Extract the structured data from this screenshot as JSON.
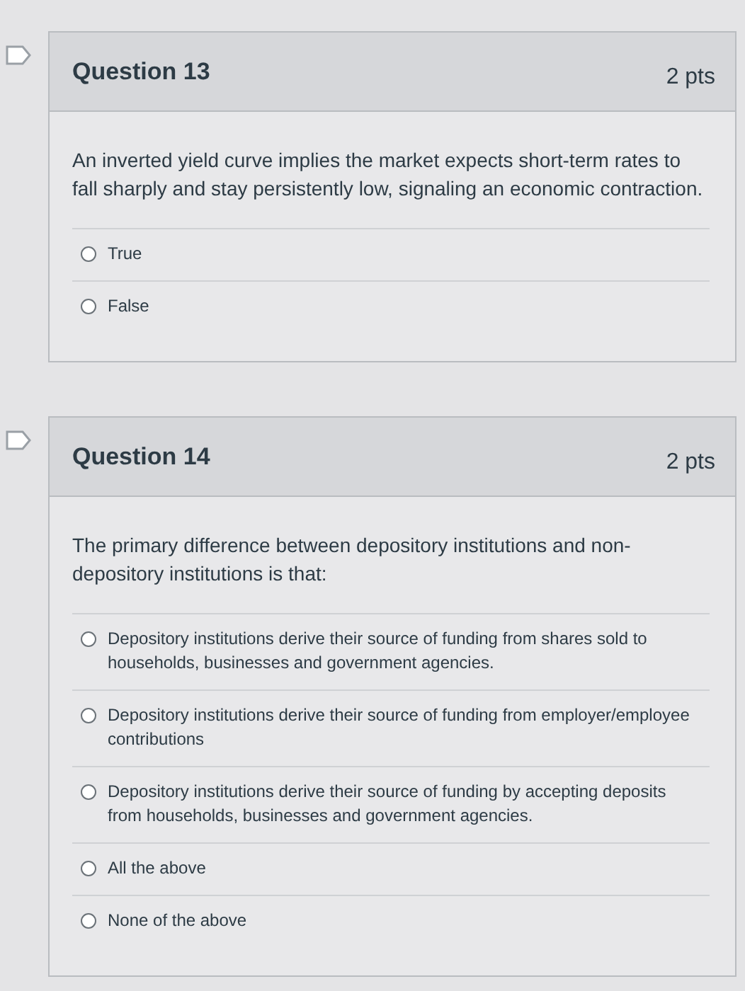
{
  "questions": [
    {
      "title": "Question 13",
      "points": "2 pts",
      "text": "An inverted yield curve implies the market expects short-term rates to fall sharply and stay persistently low, signaling an economic contraction.",
      "answers": [
        {
          "label": "True",
          "selected": false
        },
        {
          "label": "False",
          "selected": false
        }
      ]
    },
    {
      "title": "Question 14",
      "points": "2 pts",
      "text": "The primary difference between depository institutions and non-depository institutions is that:",
      "answers": [
        {
          "label": "Depository institutions derive their source of funding from shares sold to households, businesses and government agencies.",
          "selected": false
        },
        {
          "label": "Depository institutions derive their source of funding from employer/employee contributions",
          "selected": false
        },
        {
          "label": "Depository institutions derive their source of funding by accepting deposits from households, businesses and government agencies.",
          "selected": false
        },
        {
          "label": "All the above",
          "selected": false
        },
        {
          "label": "None of the above",
          "selected": false
        }
      ]
    }
  ]
}
